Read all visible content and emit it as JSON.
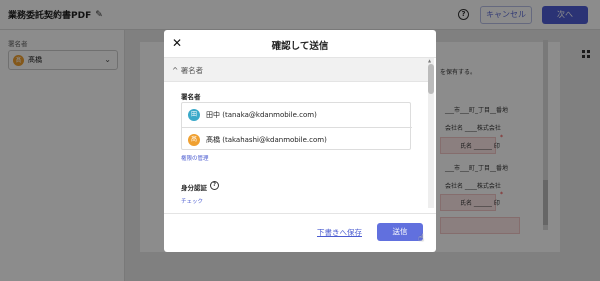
{
  "header": {
    "doc_title": "業務委託契約書PDF",
    "help_icon": "?",
    "cancel_label": "キャンセル",
    "next_label": "次へ"
  },
  "sidebar": {
    "label": "署名者",
    "selected_signer": "髙橋",
    "selected_initial": "髙"
  },
  "document": {
    "line1": "を保有する。",
    "line2": "___市___町_丁目__番地",
    "line3": "会社名 ____株式会社",
    "line4": "氏名 ______ 印",
    "line5": "___市___町_丁目__番地",
    "line6": "会社名 ____株式会社",
    "line7": "氏名 ______ 印",
    "required_mark": "*"
  },
  "modal": {
    "title": "確認して送信",
    "section_label": "署名者",
    "signers_header": "署名者",
    "signers": [
      {
        "initial": "田",
        "text": "田中 (tanaka@kdanmobile.com)"
      },
      {
        "initial": "髙",
        "text": "髙橋 (takahashi@kdanmobile.com)"
      }
    ],
    "permission_link": "権限の管理",
    "id_verification_label": "身分認証",
    "id_verification_help": "?",
    "check_link": "チェック",
    "save_draft_label": "下書きへ保存",
    "send_label": "送信"
  },
  "colors": {
    "accent": "#4f5ed6",
    "avatar_blue": "#3aa9c9",
    "avatar_orange": "#f0a030"
  }
}
